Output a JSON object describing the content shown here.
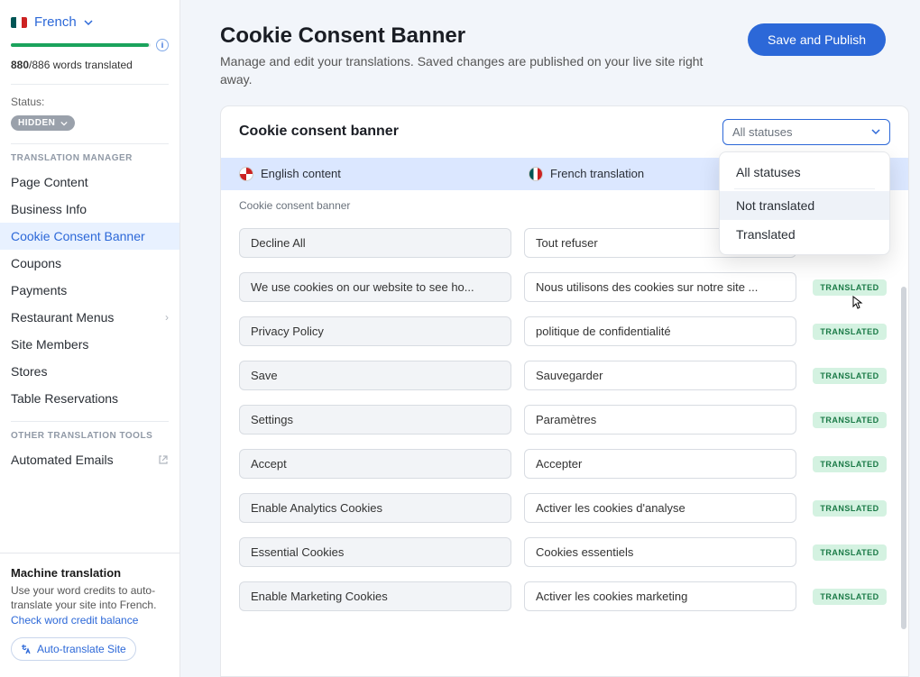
{
  "language": {
    "name": "French"
  },
  "progress": {
    "translated": 880,
    "total": 886,
    "label": "words translated"
  },
  "status": {
    "label": "Status:",
    "value": "HIDDEN"
  },
  "sections": {
    "manager": "TRANSLATION MANAGER",
    "other": "OTHER TRANSLATION TOOLS"
  },
  "nav": {
    "manager": [
      "Page Content",
      "Business Info",
      "Cookie Consent Banner",
      "Coupons",
      "Payments",
      "Restaurant Menus",
      "Site Members",
      "Stores",
      "Table Reservations"
    ],
    "other": [
      "Automated Emails"
    ]
  },
  "machine": {
    "title": "Machine translation",
    "desc": "Use your word credits to auto-translate your site into French.",
    "link": "Check word credit balance",
    "button": "Auto-translate Site"
  },
  "header": {
    "title": "Cookie Consent Banner",
    "subtitle": "Manage and edit your translations. Saved changes are published on your live site right away.",
    "publish": "Save and Publish"
  },
  "panel": {
    "title": "Cookie consent banner",
    "filter_label": "All statuses",
    "options": [
      "All statuses",
      "Not translated",
      "Translated"
    ]
  },
  "columns": {
    "src": "English content",
    "tr": "French translation"
  },
  "group_label": "Cookie consent banner",
  "badge_label": "TRANSLATED",
  "rows": [
    {
      "src": "Decline All",
      "tr": "Tout refuser"
    },
    {
      "src": "We use cookies on our website to see ho...",
      "tr": "Nous utilisons des cookies sur notre site ..."
    },
    {
      "src": "Privacy Policy",
      "tr": "politique de confidentialité"
    },
    {
      "src": "Save",
      "tr": "Sauvegarder"
    },
    {
      "src": "Settings",
      "tr": "Paramètres"
    },
    {
      "src": "Accept",
      "tr": "Accepter"
    },
    {
      "src": "Enable Analytics Cookies",
      "tr": "Activer les cookies d'analyse"
    },
    {
      "src": "Essential Cookies",
      "tr": "Cookies essentiels"
    },
    {
      "src": "Enable Marketing Cookies",
      "tr": "Activer les cookies marketing"
    }
  ]
}
